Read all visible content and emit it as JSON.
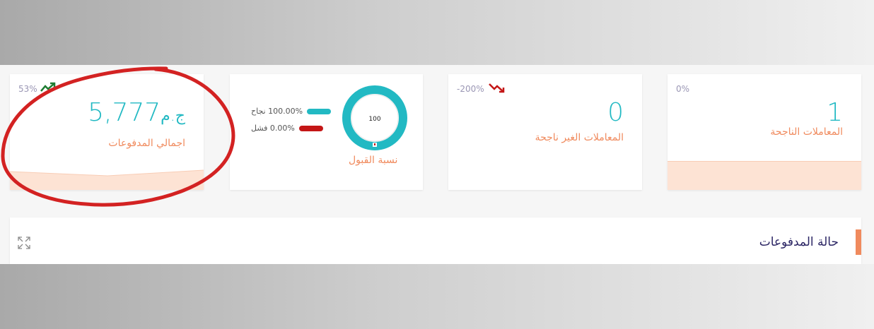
{
  "cards": {
    "successful": {
      "value": "1",
      "label": "المعاملات الناجحة",
      "percent": "0%"
    },
    "failed": {
      "value": "0",
      "label": "المعاملات الغير ناجحة",
      "percent": "-200%"
    },
    "acceptance": {
      "label": "نسبة القبول",
      "gauge_value": "100",
      "legend": [
        {
          "text": "100.00% نجاح",
          "color": "#22b9c3"
        },
        {
          "text": "0.00% فشل",
          "color": "#c41616"
        }
      ]
    },
    "total": {
      "amount": "5,777",
      "currency": "ج.م",
      "label": "اجمالي المدفوعات",
      "percent": "53%"
    }
  },
  "panel": {
    "title": "حالة المدفوعات"
  },
  "colors": {
    "accent": "#f08a5d",
    "teal": "#22b9c3",
    "up": "#1e7d32",
    "down": "#c41616",
    "annotation": "#d32222"
  }
}
